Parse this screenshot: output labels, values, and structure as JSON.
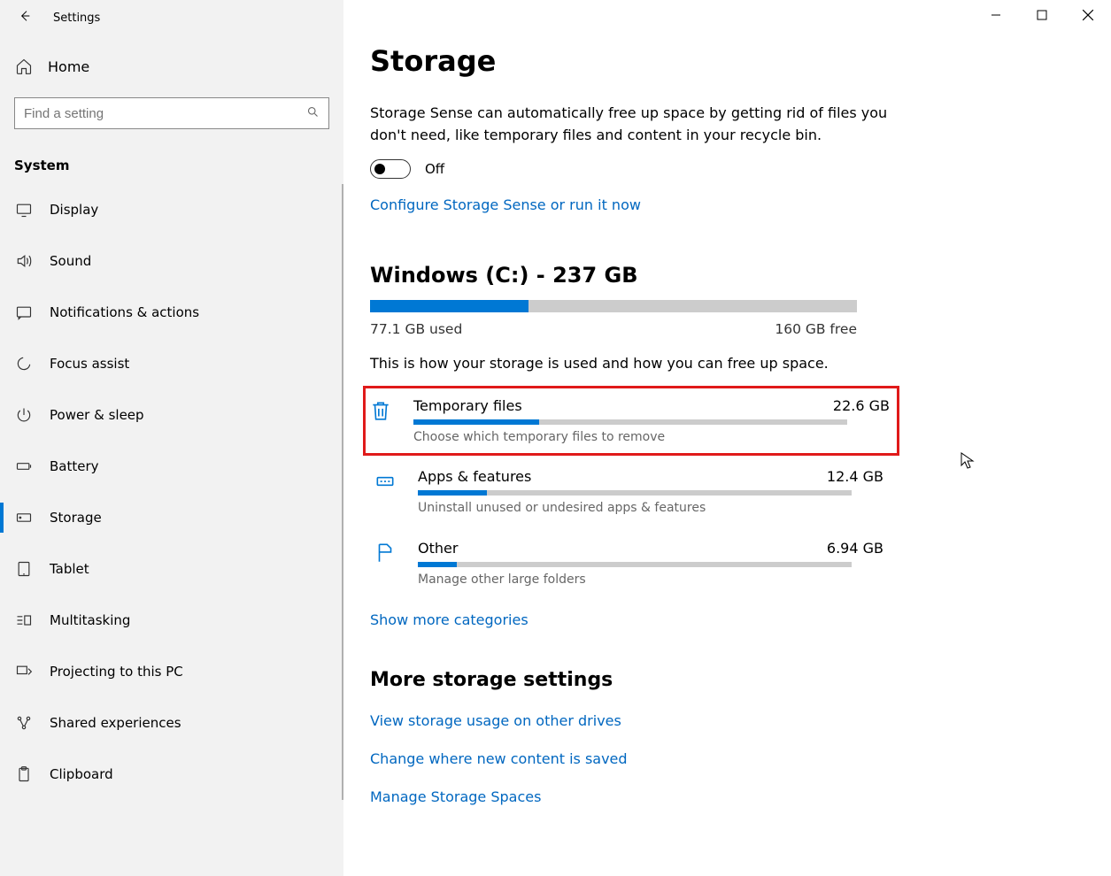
{
  "header": {
    "app_title": "Settings"
  },
  "home_label": "Home",
  "search": {
    "placeholder": "Find a setting"
  },
  "section": "System",
  "nav": [
    {
      "label": "Display"
    },
    {
      "label": "Sound"
    },
    {
      "label": "Notifications & actions"
    },
    {
      "label": "Focus assist"
    },
    {
      "label": "Power & sleep"
    },
    {
      "label": "Battery"
    },
    {
      "label": "Storage"
    },
    {
      "label": "Tablet"
    },
    {
      "label": "Multitasking"
    },
    {
      "label": "Projecting to this PC"
    },
    {
      "label": "Shared experiences"
    },
    {
      "label": "Clipboard"
    }
  ],
  "page": {
    "title": "Storage",
    "sense_desc": "Storage Sense can automatically free up space by getting rid of files you don't need, like temporary files and content in your recycle bin.",
    "toggle_label": "Off",
    "configure_link": "Configure Storage Sense or run it now",
    "drive_title": "Windows (C:) - 237 GB",
    "drive_used_pct": 32.5,
    "used_label": "77.1 GB used",
    "free_label": "160 GB free",
    "usage_desc": "This is how your storage is used and how you can free up space.",
    "categories": [
      {
        "name": "Temporary files",
        "size": "22.6 GB",
        "sub": "Choose which temporary files to remove",
        "pct": 29
      },
      {
        "name": "Apps & features",
        "size": "12.4 GB",
        "sub": "Uninstall unused or undesired apps & features",
        "pct": 16
      },
      {
        "name": "Other",
        "size": "6.94 GB",
        "sub": "Manage other large folders",
        "pct": 9
      }
    ],
    "show_more": "Show more categories",
    "more_title": "More storage settings",
    "more_links": [
      "View storage usage on other drives",
      "Change where new content is saved",
      "Manage Storage Spaces"
    ]
  }
}
